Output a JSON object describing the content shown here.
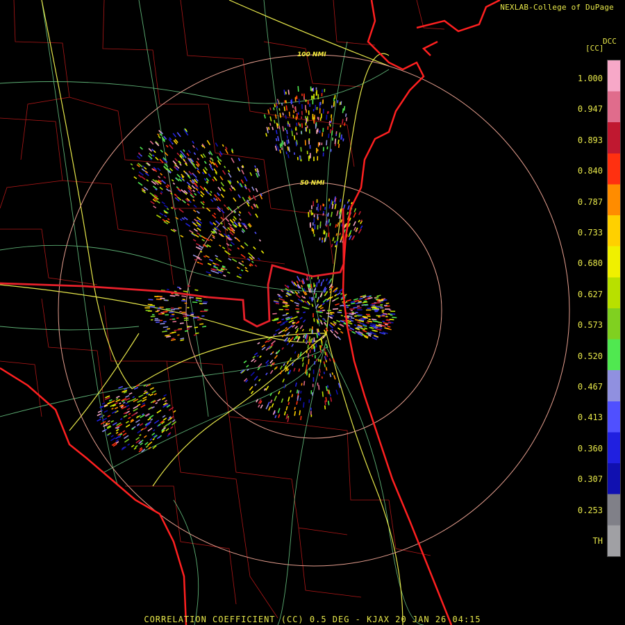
{
  "header": {
    "credit": "NEXLAB-College of DuPage"
  },
  "legend": {
    "title": "DCC",
    "unit": "[CC]",
    "ticks": [
      "1.000",
      "0.947",
      "0.893",
      "0.840",
      "0.787",
      "0.733",
      "0.680",
      "0.627",
      "0.573",
      "0.520",
      "0.467",
      "0.413",
      "0.360",
      "0.307",
      "0.253",
      "TH"
    ],
    "colors": [
      "#f7a8c8",
      "#e06c8c",
      "#c01830",
      "#ff3010",
      "#ff8c00",
      "#ffd000",
      "#f0f000",
      "#b8e000",
      "#80d020",
      "#50e850",
      "#9090e0",
      "#5050ff",
      "#2020e0",
      "#1010b0",
      "#808088",
      "#a0a0a4"
    ]
  },
  "map": {
    "ring_labels": [
      "100 NMI",
      "50 NMI"
    ],
    "colors": {
      "state_border": "#e8202a",
      "county": "#b01818",
      "coast": "#ff2020",
      "highway": "#e8e84a",
      "road": "#6fd08a",
      "range_ring": "#e8a090"
    }
  },
  "footer": {
    "caption": "CORRELATION COEFFICIENT (CC) 0.5 DEG - KJAX 20 JAN 26 04:15"
  }
}
